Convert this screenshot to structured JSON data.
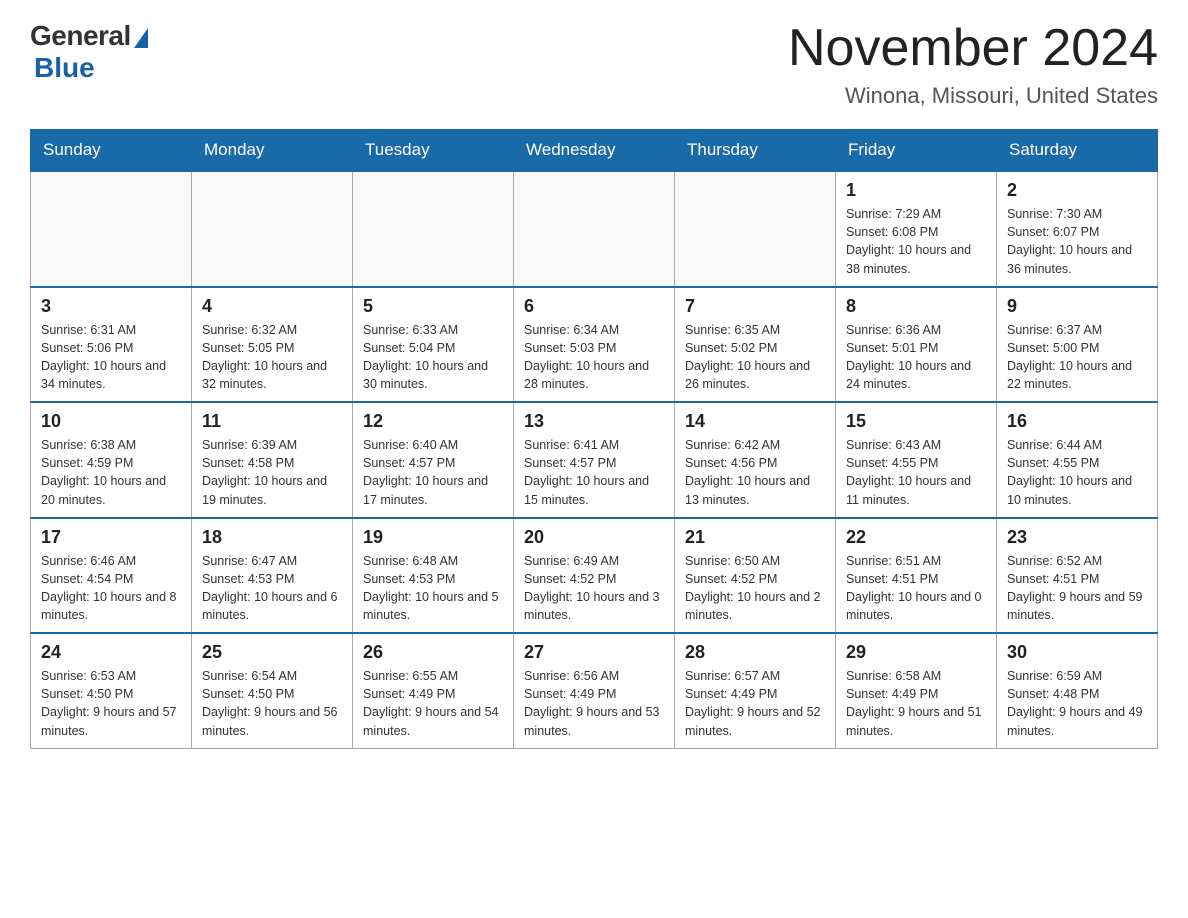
{
  "header": {
    "logo_general": "General",
    "logo_blue": "Blue",
    "month_title": "November 2024",
    "location": "Winona, Missouri, United States"
  },
  "days_of_week": [
    "Sunday",
    "Monday",
    "Tuesday",
    "Wednesday",
    "Thursday",
    "Friday",
    "Saturday"
  ],
  "weeks": [
    [
      {
        "day": "",
        "info": ""
      },
      {
        "day": "",
        "info": ""
      },
      {
        "day": "",
        "info": ""
      },
      {
        "day": "",
        "info": ""
      },
      {
        "day": "",
        "info": ""
      },
      {
        "day": "1",
        "info": "Sunrise: 7:29 AM\nSunset: 6:08 PM\nDaylight: 10 hours and 38 minutes."
      },
      {
        "day": "2",
        "info": "Sunrise: 7:30 AM\nSunset: 6:07 PM\nDaylight: 10 hours and 36 minutes."
      }
    ],
    [
      {
        "day": "3",
        "info": "Sunrise: 6:31 AM\nSunset: 5:06 PM\nDaylight: 10 hours and 34 minutes."
      },
      {
        "day": "4",
        "info": "Sunrise: 6:32 AM\nSunset: 5:05 PM\nDaylight: 10 hours and 32 minutes."
      },
      {
        "day": "5",
        "info": "Sunrise: 6:33 AM\nSunset: 5:04 PM\nDaylight: 10 hours and 30 minutes."
      },
      {
        "day": "6",
        "info": "Sunrise: 6:34 AM\nSunset: 5:03 PM\nDaylight: 10 hours and 28 minutes."
      },
      {
        "day": "7",
        "info": "Sunrise: 6:35 AM\nSunset: 5:02 PM\nDaylight: 10 hours and 26 minutes."
      },
      {
        "day": "8",
        "info": "Sunrise: 6:36 AM\nSunset: 5:01 PM\nDaylight: 10 hours and 24 minutes."
      },
      {
        "day": "9",
        "info": "Sunrise: 6:37 AM\nSunset: 5:00 PM\nDaylight: 10 hours and 22 minutes."
      }
    ],
    [
      {
        "day": "10",
        "info": "Sunrise: 6:38 AM\nSunset: 4:59 PM\nDaylight: 10 hours and 20 minutes."
      },
      {
        "day": "11",
        "info": "Sunrise: 6:39 AM\nSunset: 4:58 PM\nDaylight: 10 hours and 19 minutes."
      },
      {
        "day": "12",
        "info": "Sunrise: 6:40 AM\nSunset: 4:57 PM\nDaylight: 10 hours and 17 minutes."
      },
      {
        "day": "13",
        "info": "Sunrise: 6:41 AM\nSunset: 4:57 PM\nDaylight: 10 hours and 15 minutes."
      },
      {
        "day": "14",
        "info": "Sunrise: 6:42 AM\nSunset: 4:56 PM\nDaylight: 10 hours and 13 minutes."
      },
      {
        "day": "15",
        "info": "Sunrise: 6:43 AM\nSunset: 4:55 PM\nDaylight: 10 hours and 11 minutes."
      },
      {
        "day": "16",
        "info": "Sunrise: 6:44 AM\nSunset: 4:55 PM\nDaylight: 10 hours and 10 minutes."
      }
    ],
    [
      {
        "day": "17",
        "info": "Sunrise: 6:46 AM\nSunset: 4:54 PM\nDaylight: 10 hours and 8 minutes."
      },
      {
        "day": "18",
        "info": "Sunrise: 6:47 AM\nSunset: 4:53 PM\nDaylight: 10 hours and 6 minutes."
      },
      {
        "day": "19",
        "info": "Sunrise: 6:48 AM\nSunset: 4:53 PM\nDaylight: 10 hours and 5 minutes."
      },
      {
        "day": "20",
        "info": "Sunrise: 6:49 AM\nSunset: 4:52 PM\nDaylight: 10 hours and 3 minutes."
      },
      {
        "day": "21",
        "info": "Sunrise: 6:50 AM\nSunset: 4:52 PM\nDaylight: 10 hours and 2 minutes."
      },
      {
        "day": "22",
        "info": "Sunrise: 6:51 AM\nSunset: 4:51 PM\nDaylight: 10 hours and 0 minutes."
      },
      {
        "day": "23",
        "info": "Sunrise: 6:52 AM\nSunset: 4:51 PM\nDaylight: 9 hours and 59 minutes."
      }
    ],
    [
      {
        "day": "24",
        "info": "Sunrise: 6:53 AM\nSunset: 4:50 PM\nDaylight: 9 hours and 57 minutes."
      },
      {
        "day": "25",
        "info": "Sunrise: 6:54 AM\nSunset: 4:50 PM\nDaylight: 9 hours and 56 minutes."
      },
      {
        "day": "26",
        "info": "Sunrise: 6:55 AM\nSunset: 4:49 PM\nDaylight: 9 hours and 54 minutes."
      },
      {
        "day": "27",
        "info": "Sunrise: 6:56 AM\nSunset: 4:49 PM\nDaylight: 9 hours and 53 minutes."
      },
      {
        "day": "28",
        "info": "Sunrise: 6:57 AM\nSunset: 4:49 PM\nDaylight: 9 hours and 52 minutes."
      },
      {
        "day": "29",
        "info": "Sunrise: 6:58 AM\nSunset: 4:49 PM\nDaylight: 9 hours and 51 minutes."
      },
      {
        "day": "30",
        "info": "Sunrise: 6:59 AM\nSunset: 4:48 PM\nDaylight: 9 hours and 49 minutes."
      }
    ]
  ]
}
